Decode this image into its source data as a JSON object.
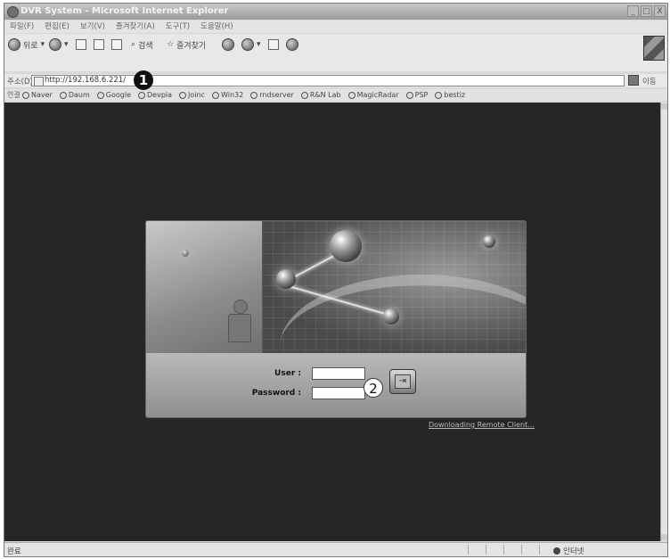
{
  "window": {
    "title": "DVR System - Microsoft Internet Explorer",
    "controls": [
      "_",
      "□",
      "X"
    ]
  },
  "menu": [
    "파일(F)",
    "편집(E)",
    "보기(V)",
    "즐겨찾기(A)",
    "도구(T)",
    "도움말(H)"
  ],
  "toolbar": {
    "back_label": "뒤로",
    "search_label": "검색",
    "favorites_label": "즐겨찾기"
  },
  "address": {
    "label": "주소(D)",
    "url": "http://192.168.6.221/",
    "go_label": "이동"
  },
  "links": {
    "label": "연결",
    "items": [
      "Naver",
      "Daum",
      "Google",
      "Devpia",
      "Joinc",
      "Win32",
      "rndserver",
      "R&N Lab",
      "MagicRadar",
      "PSP",
      "bestiz"
    ]
  },
  "annotations": {
    "marker1": "1",
    "marker2": "2"
  },
  "login": {
    "user_label": "User :",
    "password_label": "Password :",
    "user_value": "",
    "password_value": "",
    "download_link": "Downloading Remote Client..."
  },
  "status": {
    "left": "완료",
    "zone": "인터넷"
  },
  "colors": {
    "page_background": "#262626",
    "panel": "#8e8e8e"
  }
}
